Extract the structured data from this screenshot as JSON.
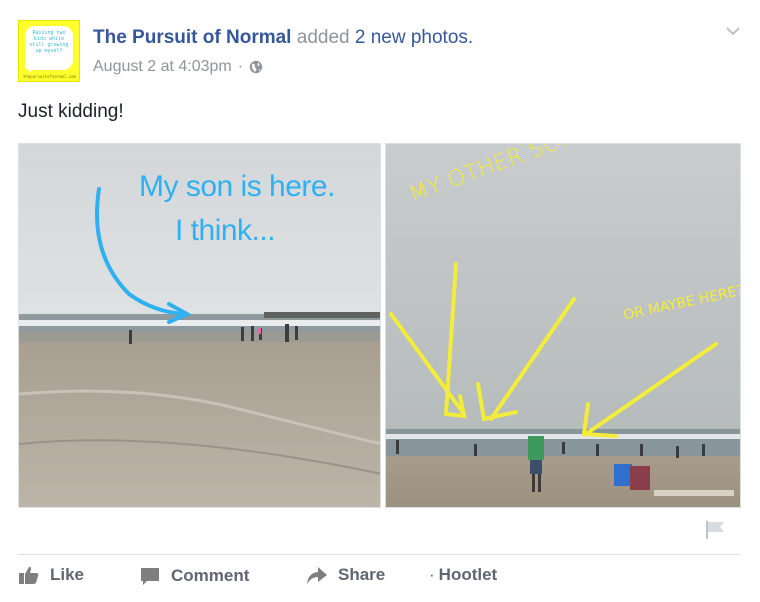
{
  "post": {
    "page_name": "The Pursuit of Normal",
    "verb": "added",
    "photo_count_text": "2 new photos.",
    "timestamp": "August 2 at 4:03pm",
    "separator": "·",
    "text": "Just kidding!",
    "avatar": {
      "text": "Raising two kids while still growing up myself",
      "site": "thepursuitofnormal.com",
      "background": "#ffff2e"
    }
  },
  "photos": {
    "left": {
      "caption_line1": "My son is here.",
      "caption_line2": "I think...",
      "caption_color": "#2fb0f0"
    },
    "right": {
      "caption_main": "MY OTHER SON IS HERE",
      "caption_secondary": "OR MAYBE HERE?",
      "caption_color": "#f2ec3a"
    }
  },
  "actions": {
    "like": "Like",
    "comment": "Comment",
    "share": "Share",
    "hootlet": "Hootlet",
    "hootlet_prefix": "·"
  },
  "colors": {
    "link": "#365899",
    "muted": "#90949c",
    "action_text": "#616770",
    "divider": "#dddfe2"
  },
  "icons": [
    "globe-icon",
    "chevron-down-icon",
    "like-icon",
    "comment-icon",
    "share-icon",
    "flag-icon"
  ]
}
